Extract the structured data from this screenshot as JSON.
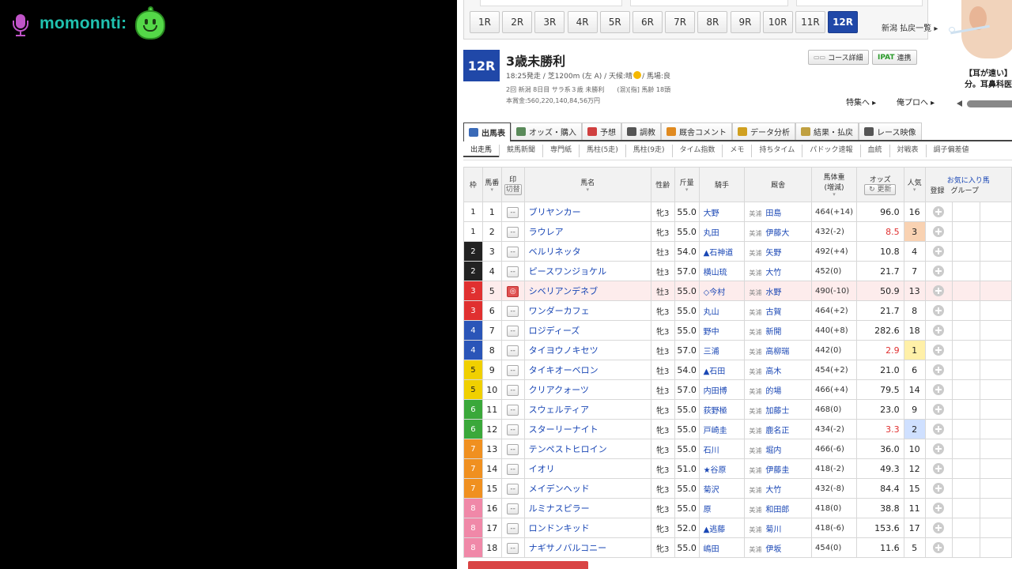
{
  "stream": {
    "username": "momonnti:",
    "mic_icon": "microphone-icon",
    "emote_icon": "green-smiley-emote"
  },
  "race_tabs": [
    "1R",
    "2R",
    "3R",
    "4R",
    "5R",
    "6R",
    "7R",
    "8R",
    "9R",
    "10R",
    "11R",
    "12R"
  ],
  "active_tab": "12R",
  "all_races_link": "新潟 払戻一覧 ▸",
  "race": {
    "badge": "12R",
    "title": "3歳未勝利",
    "info": "18:25発走 / 芝1200m (左 A) / 天候:晴",
    "info_after_sun": "/ 馬場:良",
    "info2": "2回 新潟 8日目 サラ系３歳 未勝利　　(混)[指] 馬齢 18頭",
    "info3": "本賞金:560,220,140,84,56万円"
  },
  "buttons": {
    "course": "コース詳細",
    "ipat_logo": "IPAT",
    "ipat": "連携",
    "feature": "特集へ ▸",
    "ore_pro": "俺プロへ ▸"
  },
  "ad": {
    "line1": "【耳が遠い】",
    "line2": "分。耳鼻科医"
  },
  "main_tabs": [
    {
      "label": "出馬表",
      "icon": "entry-table-icon",
      "color": "#3a6ab8"
    },
    {
      "label": "オッズ・購入",
      "icon": "odds-icon",
      "color": "#5a8a5a"
    },
    {
      "label": "予想",
      "icon": "target-icon",
      "color": "#d04040"
    },
    {
      "label": "調教",
      "icon": "stopwatch-icon",
      "color": "#555"
    },
    {
      "label": "厩舎コメント",
      "icon": "comment-icon",
      "color": "#e08a20"
    },
    {
      "label": "データ分析",
      "icon": "bar-chart-icon",
      "color": "#d0a020"
    },
    {
      "label": "結果・払戻",
      "icon": "coins-icon",
      "color": "#c0a040"
    },
    {
      "label": "レース映像",
      "icon": "video-icon",
      "color": "#555"
    }
  ],
  "sub_tabs": [
    "出走馬",
    "競馬新聞",
    "専門紙",
    "馬柱(5走)",
    "馬柱(9走)",
    "タイム指数",
    "メモ",
    "持ちタイム",
    "パドック速報",
    "血統",
    "対戦表",
    "調子偏差値"
  ],
  "table": {
    "headers": {
      "waku": "枠",
      "num": "馬番",
      "mark": "印",
      "mark_sub": "切替",
      "name": "馬名",
      "sex": "性齢",
      "weight": "斤量",
      "jockey": "騎手",
      "trainer": "厩舎",
      "body": "馬体重",
      "body_sub": "(増減)",
      "odds": "オッズ",
      "odds_sub": "更新",
      "pop": "人気",
      "fav": "お気に入り馬",
      "fav_reg": "登録",
      "fav_group": "グループ"
    },
    "waku_colors": {
      "1": "#ffffff",
      "2": "#222222",
      "3": "#e03030",
      "4": "#2a55b8",
      "5": "#f0d000",
      "6": "#3aa83a",
      "7": "#f09020",
      "8": "#f088a8"
    },
    "rows": [
      {
        "waku": "1",
        "num": "1",
        "mark": "--",
        "name": "ブリヤンカー",
        "sex": "牝3",
        "weight": "55.0",
        "jockey": "大野",
        "area": "美浦",
        "trainer": "田島",
        "body": "464(+14)",
        "odds": "96.0",
        "pop": "16"
      },
      {
        "waku": "1",
        "num": "2",
        "mark": "--",
        "name": "ラウレア",
        "sex": "牝3",
        "weight": "55.0",
        "jockey": "丸田",
        "area": "美浦",
        "trainer": "伊藤大",
        "body": "432(-2)",
        "odds": "8.5",
        "pop": "3"
      },
      {
        "waku": "2",
        "num": "3",
        "mark": "--",
        "name": "ベルリネッタ",
        "sex": "牡3",
        "weight": "54.0",
        "jockey": "▲石神道",
        "area": "美浦",
        "trainer": "矢野",
        "body": "492(+4)",
        "odds": "10.8",
        "pop": "4"
      },
      {
        "waku": "2",
        "num": "4",
        "mark": "--",
        "name": "ピースワンジョケル",
        "sex": "牡3",
        "weight": "57.0",
        "jockey": "横山琉",
        "area": "美浦",
        "trainer": "大竹",
        "body": "452(0)",
        "odds": "21.7",
        "pop": "7"
      },
      {
        "waku": "3",
        "num": "5",
        "mark": "◎",
        "name": "シベリアンデネブ",
        "sex": "牡3",
        "weight": "55.0",
        "jockey": "◇今村",
        "area": "美浦",
        "trainer": "水野",
        "body": "490(-10)",
        "odds": "50.9",
        "pop": "13"
      },
      {
        "waku": "3",
        "num": "6",
        "mark": "--",
        "name": "ワンダーカフェ",
        "sex": "牝3",
        "weight": "55.0",
        "jockey": "丸山",
        "area": "美浦",
        "trainer": "古賀",
        "body": "464(+2)",
        "odds": "21.7",
        "pop": "8"
      },
      {
        "waku": "4",
        "num": "7",
        "mark": "--",
        "name": "ロジディーズ",
        "sex": "牝3",
        "weight": "55.0",
        "jockey": "野中",
        "area": "美浦",
        "trainer": "新開",
        "body": "440(+8)",
        "odds": "282.6",
        "pop": "18"
      },
      {
        "waku": "4",
        "num": "8",
        "mark": "--",
        "name": "タイヨウノキセツ",
        "sex": "牡3",
        "weight": "57.0",
        "jockey": "三浦",
        "area": "美浦",
        "trainer": "高柳瑞",
        "body": "442(0)",
        "odds": "2.9",
        "pop": "1"
      },
      {
        "waku": "5",
        "num": "9",
        "mark": "--",
        "name": "タイキオーベロン",
        "sex": "牡3",
        "weight": "54.0",
        "jockey": "▲石田",
        "area": "美浦",
        "trainer": "高木",
        "body": "454(+2)",
        "odds": "21.0",
        "pop": "6"
      },
      {
        "waku": "5",
        "num": "10",
        "mark": "--",
        "name": "クリアクォーツ",
        "sex": "牡3",
        "weight": "57.0",
        "jockey": "内田博",
        "area": "美浦",
        "trainer": "的場",
        "body": "466(+4)",
        "odds": "79.5",
        "pop": "14"
      },
      {
        "waku": "6",
        "num": "11",
        "mark": "--",
        "name": "スウェルティア",
        "sex": "牝3",
        "weight": "55.0",
        "jockey": "荻野極",
        "area": "美浦",
        "trainer": "加藤士",
        "body": "468(0)",
        "odds": "23.0",
        "pop": "9"
      },
      {
        "waku": "6",
        "num": "12",
        "mark": "--",
        "name": "スターリーナイト",
        "sex": "牝3",
        "weight": "55.0",
        "jockey": "戸崎圭",
        "area": "美浦",
        "trainer": "鹿名正",
        "body": "434(-2)",
        "odds": "3.3",
        "pop": "2"
      },
      {
        "waku": "7",
        "num": "13",
        "mark": "--",
        "name": "テンペストヒロイン",
        "sex": "牝3",
        "weight": "55.0",
        "jockey": "石川",
        "area": "美浦",
        "trainer": "堀内",
        "body": "466(-6)",
        "odds": "36.0",
        "pop": "10"
      },
      {
        "waku": "7",
        "num": "14",
        "mark": "--",
        "name": "イオリ",
        "sex": "牝3",
        "weight": "51.0",
        "jockey": "★谷原",
        "area": "美浦",
        "trainer": "伊藤圭",
        "body": "418(-2)",
        "odds": "49.3",
        "pop": "12"
      },
      {
        "waku": "7",
        "num": "15",
        "mark": "--",
        "name": "メイデンヘッド",
        "sex": "牝3",
        "weight": "55.0",
        "jockey": "菊沢",
        "area": "美浦",
        "trainer": "大竹",
        "body": "432(-8)",
        "odds": "84.4",
        "pop": "15"
      },
      {
        "waku": "8",
        "num": "16",
        "mark": "--",
        "name": "ルミナスピラー",
        "sex": "牝3",
        "weight": "55.0",
        "jockey": "原",
        "area": "美浦",
        "trainer": "和田郎",
        "body": "418(0)",
        "odds": "38.8",
        "pop": "11"
      },
      {
        "waku": "8",
        "num": "17",
        "mark": "--",
        "name": "ロンドンキッド",
        "sex": "牝3",
        "weight": "52.0",
        "jockey": "▲逃藤",
        "area": "美浦",
        "trainer": "菊川",
        "body": "418(-6)",
        "odds": "153.6",
        "pop": "17"
      },
      {
        "waku": "8",
        "num": "18",
        "mark": "--",
        "name": "ナギサノバルコニー",
        "sex": "牝3",
        "weight": "55.0",
        "jockey": "嶋田",
        "area": "美浦",
        "trainer": "伊坂",
        "body": "454(0)",
        "odds": "11.6",
        "pop": "5"
      }
    ]
  }
}
